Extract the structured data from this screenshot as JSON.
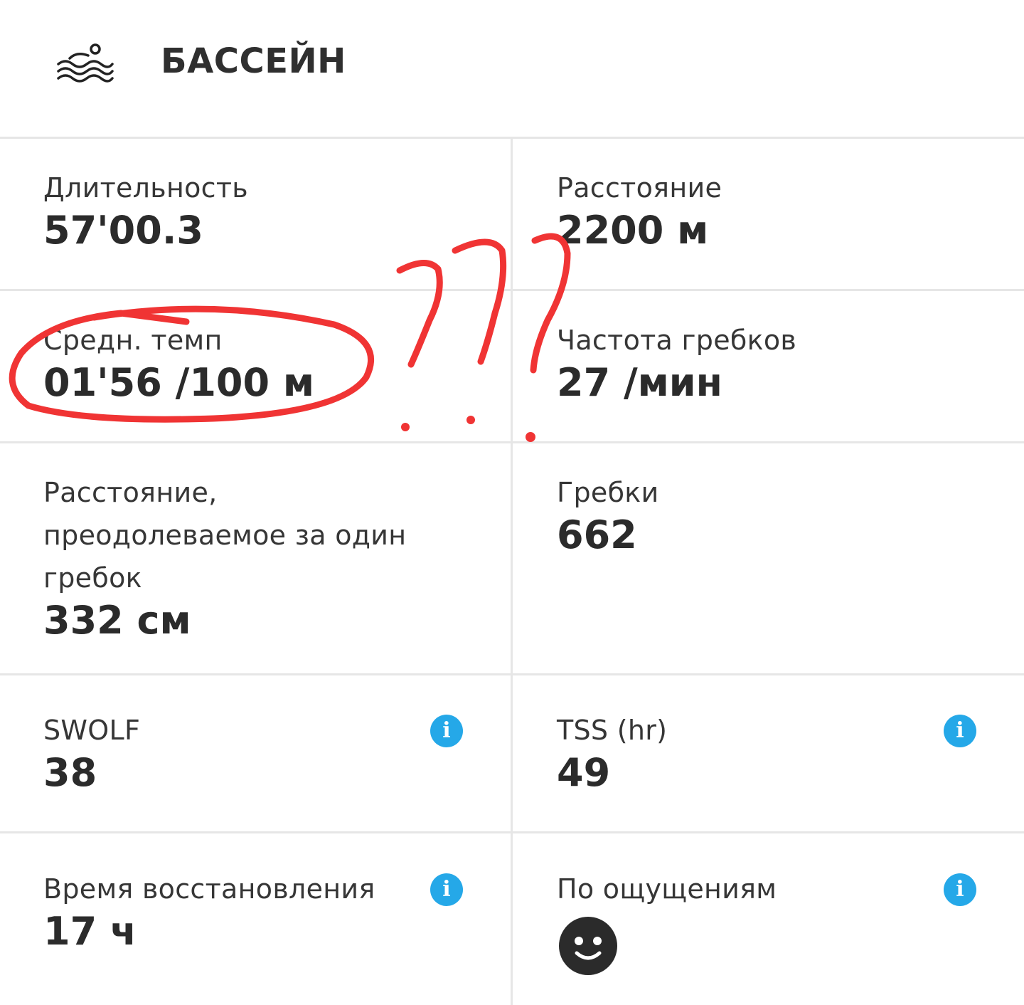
{
  "header": {
    "icon": "swimming-pool-icon",
    "title": "БАССЕЙН"
  },
  "metrics": [
    {
      "label": "Длительность",
      "value": "57'00.3"
    },
    {
      "label": "Расстояние",
      "value": "2200 м"
    },
    {
      "label": "Средн. темп",
      "value": "01'56 /100 м"
    },
    {
      "label": "Частота гребков",
      "value": "27 /мин"
    },
    {
      "label_lines": [
        "Расстояние,",
        "преодолеваемое за один",
        "гребок"
      ],
      "value": "332 см"
    },
    {
      "label": "Гребки",
      "value": "662"
    },
    {
      "label": "SWOLF",
      "value": "38",
      "info_icon": "info-icon"
    },
    {
      "label": "TSS (hr)",
      "value": "49",
      "info_icon": "info-icon"
    },
    {
      "label": "Время восстановления",
      "value": "17 ч",
      "info_icon": "info-icon"
    },
    {
      "label": "По ощущениям",
      "value_icon": "smiley-face-icon",
      "info_icon": "info-icon"
    }
  ],
  "colors": {
    "info_blue": "#25a8e8",
    "divider": "#e6e6e6",
    "annotation_red": "#f03434",
    "text_dark": "#2b2b2b"
  }
}
